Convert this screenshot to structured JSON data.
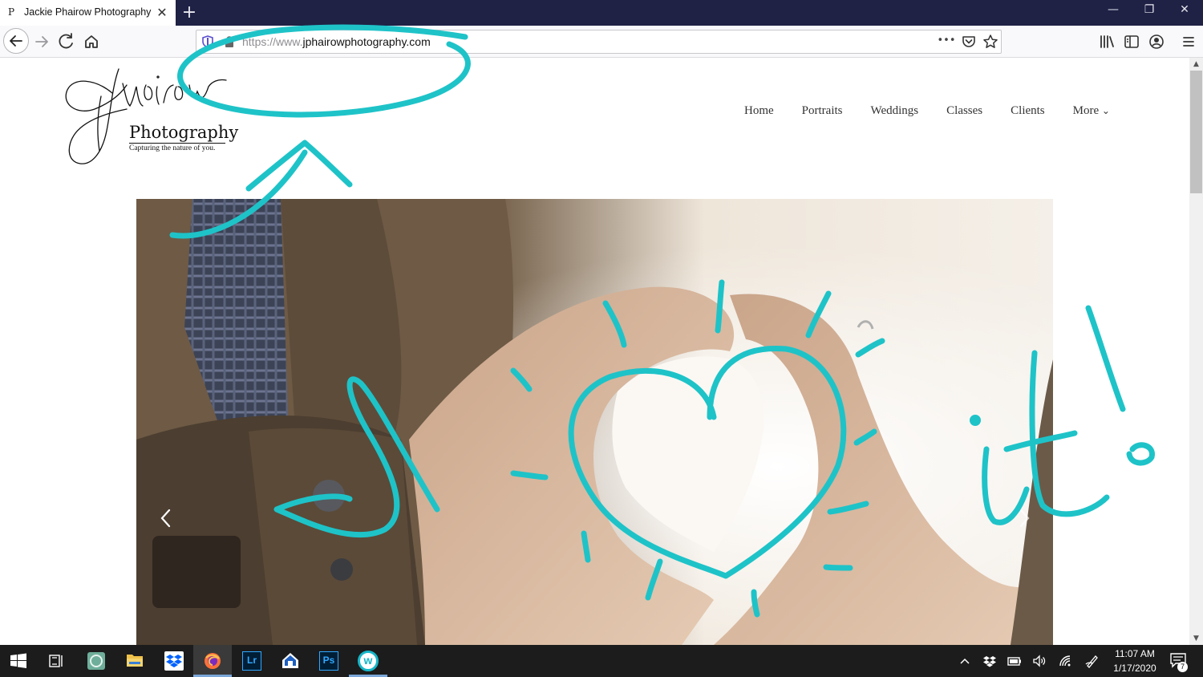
{
  "browser": {
    "tab": {
      "favicon": "P",
      "title": "Jackie Phairow Photography",
      "close_glyph": "✕"
    },
    "new_tab_glyph": "+",
    "window_controls": {
      "minimize": "—",
      "restore": "❐",
      "close": "✕"
    },
    "url": {
      "prefix": "https://www.",
      "host": "jphairowphotography.com"
    },
    "page_actions_glyph": "•••"
  },
  "site": {
    "logo": {
      "word": "Photography",
      "tagline": "Capturing the nature of you."
    },
    "nav": [
      {
        "label": "Home"
      },
      {
        "label": "Portraits"
      },
      {
        "label": "Weddings"
      },
      {
        "label": "Classes"
      },
      {
        "label": "Clients"
      },
      {
        "label": "More"
      }
    ],
    "nav_more_glyph": "⌄"
  },
  "taskbar": {
    "time": "11:07 AM",
    "date": "1/17/2020",
    "notification_count": "7",
    "apps": [
      {
        "icon": "start-icon"
      },
      {
        "icon": "task-view-icon"
      },
      {
        "icon": "app-icon-green"
      },
      {
        "icon": "file-explorer-icon"
      },
      {
        "icon": "dropbox-icon"
      },
      {
        "icon": "firefox-icon"
      },
      {
        "icon": "lightroom-icon",
        "label": "Lr"
      },
      {
        "icon": "home-app-icon"
      },
      {
        "icon": "photoshop-icon",
        "label": "Ps"
      },
      {
        "icon": "w-app-icon",
        "label": "w"
      }
    ]
  },
  "colors": {
    "title_bar": "#1f2145",
    "annotation_ink": "#1ec3c8",
    "taskbar": "#1c1c1c"
  }
}
